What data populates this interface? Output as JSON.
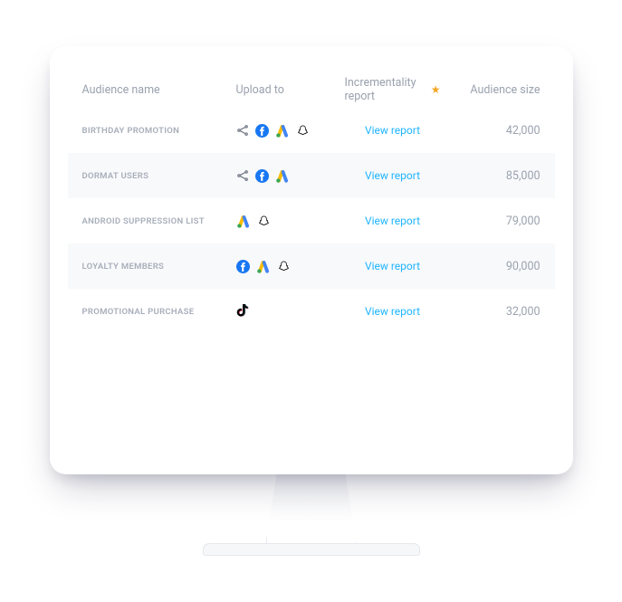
{
  "headers": {
    "name": "Audience name",
    "upload": "Upload to",
    "report": "Incrementality report",
    "size": "Audience size"
  },
  "view_report_label": "View report",
  "rows": [
    {
      "name": "BIRTHDAY PROMOTION",
      "icons": [
        "share",
        "facebook",
        "googleads",
        "snapchat"
      ],
      "size": "42,000"
    },
    {
      "name": "DORMAT USERS",
      "icons": [
        "share",
        "facebook",
        "googleads"
      ],
      "size": "85,000"
    },
    {
      "name": "ANDROID SUPPRESSION LIST",
      "icons": [
        "googleads",
        "snapchat"
      ],
      "size": "79,000"
    },
    {
      "name": "LOYALTY MEMBERS",
      "icons": [
        "facebook",
        "googleads",
        "snapchat"
      ],
      "size": "90,000"
    },
    {
      "name": "PROMOTIONAL PURCHASE",
      "icons": [
        "tiktok"
      ],
      "size": "32,000"
    }
  ]
}
